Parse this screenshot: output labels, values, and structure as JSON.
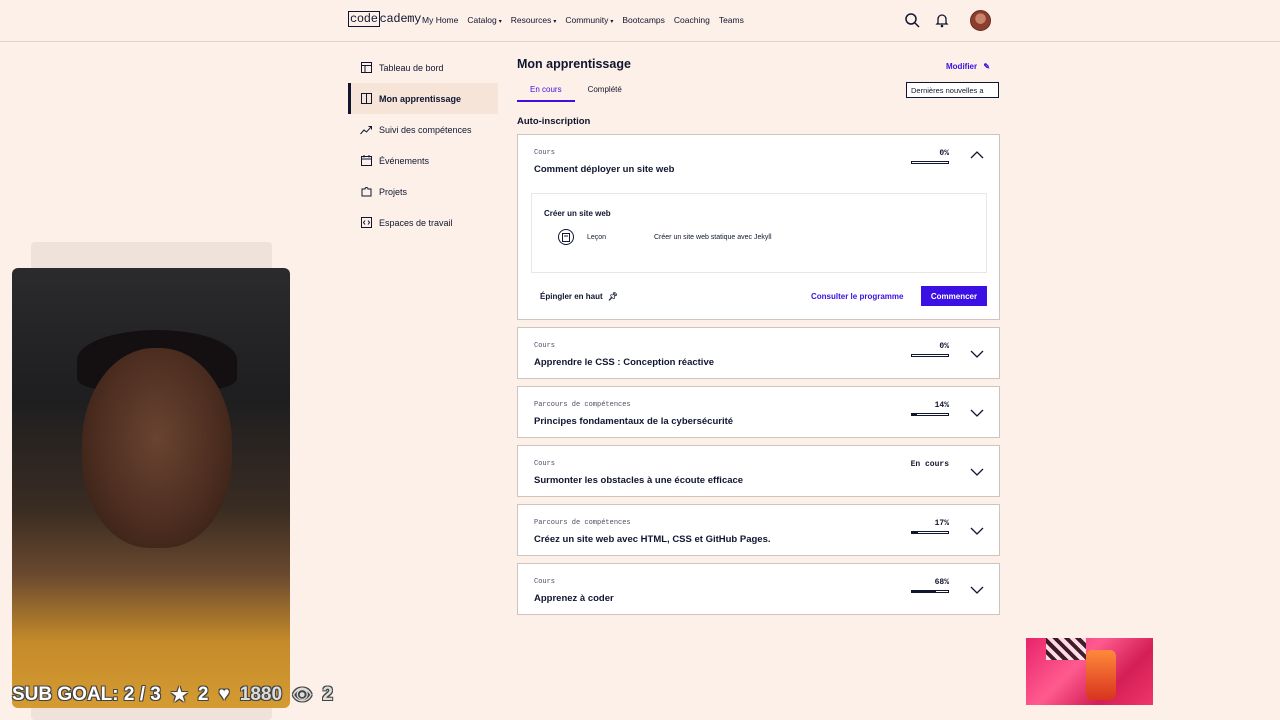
{
  "nav": {
    "logo_code": "code",
    "logo_rest": "cademy",
    "links": [
      {
        "label": "My Home",
        "caret": ""
      },
      {
        "label": "Catalog",
        "caret": "▾"
      },
      {
        "label": "Resources",
        "caret": "▾"
      },
      {
        "label": "Community",
        "caret": "▾"
      },
      {
        "label": "Bootcamps",
        "caret": ""
      },
      {
        "label": "Coaching",
        "caret": ""
      },
      {
        "label": "Teams",
        "caret": ""
      }
    ],
    "icons": [
      "search-icon",
      "bell-icon"
    ]
  },
  "sidebar": {
    "items": [
      {
        "label": "Tableau de bord",
        "icon": "dashboard-icon"
      },
      {
        "label": "Mon apprentissage",
        "icon": "book-icon",
        "active": true
      },
      {
        "label": "Suivi des compétences",
        "icon": "trend-icon"
      },
      {
        "label": "Événements",
        "icon": "calendar-icon"
      },
      {
        "label": "Projets",
        "icon": "puzzle-icon"
      },
      {
        "label": "Espaces de travail",
        "icon": "code-icon"
      }
    ]
  },
  "main": {
    "title": "Mon apprentissage",
    "modify": "Modifier",
    "tabs": [
      {
        "label": "En cours"
      },
      {
        "label": "Complété"
      }
    ],
    "sort_value": "Dernières nouvelles a",
    "section_title": "Auto-inscription",
    "expanded": {
      "type": "Cours",
      "title": "Comment déployer un site web",
      "progress_label": "0%",
      "progress": 0,
      "sub_title": "Créer un site web",
      "lesson_type": "Leçon",
      "lesson_name": "Créer un site web statique avec Jekyll",
      "pin_label": "Épingler en haut",
      "syllabus_label": "Consulter le programme",
      "start_label": "Commencer"
    },
    "cards": [
      {
        "type": "Cours",
        "title": "Apprendre le CSS : Conception réactive",
        "progress_label": "0%",
        "progress": 0
      },
      {
        "type": "Parcours de compétences",
        "title": "Principes fondamentaux de la cybersécurité",
        "progress_label": "14%",
        "progress": 14
      },
      {
        "type": "Cours",
        "title": "Surmonter les obstacles à une écoute efficace",
        "progress_label": "En cours",
        "progress": null
      },
      {
        "type": "Parcours de compétences",
        "title": "Créez un site web avec HTML, CSS et GitHub Pages.",
        "progress_label": "17%",
        "progress": 17
      },
      {
        "type": "Cours",
        "title": "Apprenez à coder",
        "progress_label": "68%",
        "progress": 68
      }
    ]
  },
  "overlay": {
    "sub_goal": "SUB GOAL: 2 / 3",
    "stars": "2",
    "hearts": "1880",
    "viewers": "2"
  },
  "colors": {
    "accent": "#3a10e5",
    "background": "#fdf0e8",
    "ink": "#10162f"
  }
}
